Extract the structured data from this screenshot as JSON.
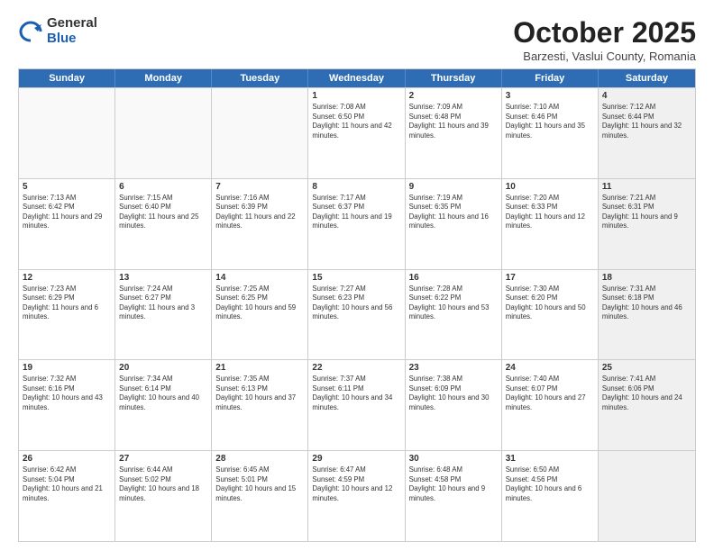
{
  "header": {
    "logo_general": "General",
    "logo_blue": "Blue",
    "month_title": "October 2025",
    "subtitle": "Barzesti, Vaslui County, Romania"
  },
  "weekdays": [
    "Sunday",
    "Monday",
    "Tuesday",
    "Wednesday",
    "Thursday",
    "Friday",
    "Saturday"
  ],
  "rows": [
    [
      {
        "day": "",
        "sunrise": "",
        "sunset": "",
        "daylight": "",
        "empty": true
      },
      {
        "day": "",
        "sunrise": "",
        "sunset": "",
        "daylight": "",
        "empty": true
      },
      {
        "day": "",
        "sunrise": "",
        "sunset": "",
        "daylight": "",
        "empty": true
      },
      {
        "day": "1",
        "sunrise": "Sunrise: 7:08 AM",
        "sunset": "Sunset: 6:50 PM",
        "daylight": "Daylight: 11 hours and 42 minutes."
      },
      {
        "day": "2",
        "sunrise": "Sunrise: 7:09 AM",
        "sunset": "Sunset: 6:48 PM",
        "daylight": "Daylight: 11 hours and 39 minutes."
      },
      {
        "day": "3",
        "sunrise": "Sunrise: 7:10 AM",
        "sunset": "Sunset: 6:46 PM",
        "daylight": "Daylight: 11 hours and 35 minutes."
      },
      {
        "day": "4",
        "sunrise": "Sunrise: 7:12 AM",
        "sunset": "Sunset: 6:44 PM",
        "daylight": "Daylight: 11 hours and 32 minutes.",
        "shaded": true
      }
    ],
    [
      {
        "day": "5",
        "sunrise": "Sunrise: 7:13 AM",
        "sunset": "Sunset: 6:42 PM",
        "daylight": "Daylight: 11 hours and 29 minutes."
      },
      {
        "day": "6",
        "sunrise": "Sunrise: 7:15 AM",
        "sunset": "Sunset: 6:40 PM",
        "daylight": "Daylight: 11 hours and 25 minutes."
      },
      {
        "day": "7",
        "sunrise": "Sunrise: 7:16 AM",
        "sunset": "Sunset: 6:39 PM",
        "daylight": "Daylight: 11 hours and 22 minutes."
      },
      {
        "day": "8",
        "sunrise": "Sunrise: 7:17 AM",
        "sunset": "Sunset: 6:37 PM",
        "daylight": "Daylight: 11 hours and 19 minutes."
      },
      {
        "day": "9",
        "sunrise": "Sunrise: 7:19 AM",
        "sunset": "Sunset: 6:35 PM",
        "daylight": "Daylight: 11 hours and 16 minutes."
      },
      {
        "day": "10",
        "sunrise": "Sunrise: 7:20 AM",
        "sunset": "Sunset: 6:33 PM",
        "daylight": "Daylight: 11 hours and 12 minutes."
      },
      {
        "day": "11",
        "sunrise": "Sunrise: 7:21 AM",
        "sunset": "Sunset: 6:31 PM",
        "daylight": "Daylight: 11 hours and 9 minutes.",
        "shaded": true
      }
    ],
    [
      {
        "day": "12",
        "sunrise": "Sunrise: 7:23 AM",
        "sunset": "Sunset: 6:29 PM",
        "daylight": "Daylight: 11 hours and 6 minutes."
      },
      {
        "day": "13",
        "sunrise": "Sunrise: 7:24 AM",
        "sunset": "Sunset: 6:27 PM",
        "daylight": "Daylight: 11 hours and 3 minutes."
      },
      {
        "day": "14",
        "sunrise": "Sunrise: 7:25 AM",
        "sunset": "Sunset: 6:25 PM",
        "daylight": "Daylight: 10 hours and 59 minutes."
      },
      {
        "day": "15",
        "sunrise": "Sunrise: 7:27 AM",
        "sunset": "Sunset: 6:23 PM",
        "daylight": "Daylight: 10 hours and 56 minutes."
      },
      {
        "day": "16",
        "sunrise": "Sunrise: 7:28 AM",
        "sunset": "Sunset: 6:22 PM",
        "daylight": "Daylight: 10 hours and 53 minutes."
      },
      {
        "day": "17",
        "sunrise": "Sunrise: 7:30 AM",
        "sunset": "Sunset: 6:20 PM",
        "daylight": "Daylight: 10 hours and 50 minutes."
      },
      {
        "day": "18",
        "sunrise": "Sunrise: 7:31 AM",
        "sunset": "Sunset: 6:18 PM",
        "daylight": "Daylight: 10 hours and 46 minutes.",
        "shaded": true
      }
    ],
    [
      {
        "day": "19",
        "sunrise": "Sunrise: 7:32 AM",
        "sunset": "Sunset: 6:16 PM",
        "daylight": "Daylight: 10 hours and 43 minutes."
      },
      {
        "day": "20",
        "sunrise": "Sunrise: 7:34 AM",
        "sunset": "Sunset: 6:14 PM",
        "daylight": "Daylight: 10 hours and 40 minutes."
      },
      {
        "day": "21",
        "sunrise": "Sunrise: 7:35 AM",
        "sunset": "Sunset: 6:13 PM",
        "daylight": "Daylight: 10 hours and 37 minutes."
      },
      {
        "day": "22",
        "sunrise": "Sunrise: 7:37 AM",
        "sunset": "Sunset: 6:11 PM",
        "daylight": "Daylight: 10 hours and 34 minutes."
      },
      {
        "day": "23",
        "sunrise": "Sunrise: 7:38 AM",
        "sunset": "Sunset: 6:09 PM",
        "daylight": "Daylight: 10 hours and 30 minutes."
      },
      {
        "day": "24",
        "sunrise": "Sunrise: 7:40 AM",
        "sunset": "Sunset: 6:07 PM",
        "daylight": "Daylight: 10 hours and 27 minutes."
      },
      {
        "day": "25",
        "sunrise": "Sunrise: 7:41 AM",
        "sunset": "Sunset: 6:06 PM",
        "daylight": "Daylight: 10 hours and 24 minutes.",
        "shaded": true
      }
    ],
    [
      {
        "day": "26",
        "sunrise": "Sunrise: 6:42 AM",
        "sunset": "Sunset: 5:04 PM",
        "daylight": "Daylight: 10 hours and 21 minutes."
      },
      {
        "day": "27",
        "sunrise": "Sunrise: 6:44 AM",
        "sunset": "Sunset: 5:02 PM",
        "daylight": "Daylight: 10 hours and 18 minutes."
      },
      {
        "day": "28",
        "sunrise": "Sunrise: 6:45 AM",
        "sunset": "Sunset: 5:01 PM",
        "daylight": "Daylight: 10 hours and 15 minutes."
      },
      {
        "day": "29",
        "sunrise": "Sunrise: 6:47 AM",
        "sunset": "Sunset: 4:59 PM",
        "daylight": "Daylight: 10 hours and 12 minutes."
      },
      {
        "day": "30",
        "sunrise": "Sunrise: 6:48 AM",
        "sunset": "Sunset: 4:58 PM",
        "daylight": "Daylight: 10 hours and 9 minutes."
      },
      {
        "day": "31",
        "sunrise": "Sunrise: 6:50 AM",
        "sunset": "Sunset: 4:56 PM",
        "daylight": "Daylight: 10 hours and 6 minutes."
      },
      {
        "day": "",
        "sunrise": "",
        "sunset": "",
        "daylight": "",
        "empty": true,
        "shaded": true
      }
    ]
  ]
}
